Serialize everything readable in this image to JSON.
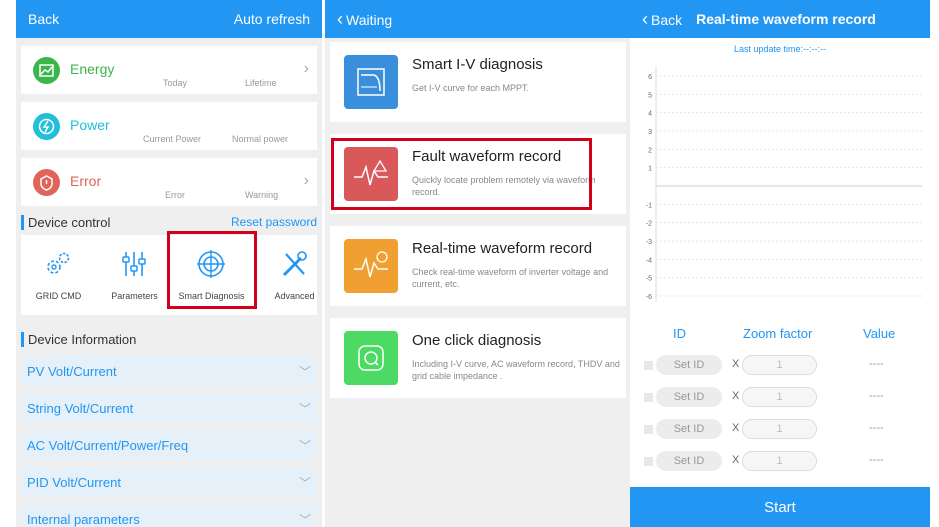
{
  "panel1": {
    "back": "Back",
    "auto_refresh": "Auto refresh",
    "energy": {
      "title": "Energy",
      "sub1": "Today",
      "sub2": "Lifetime",
      "color": "#3cb54a"
    },
    "power": {
      "title": "Power",
      "sub1": "Current Power",
      "sub2": "Normal power",
      "color": "#21c0d8"
    },
    "error": {
      "title": "Error",
      "sub1": "Error",
      "sub2": "Warning",
      "color": "#e0645a"
    },
    "device_control": "Device control",
    "reset_password": "Reset password",
    "controls": [
      "GRID CMD",
      "Parameters",
      "Smart Diagnosis",
      "Advanced"
    ],
    "device_information": "Device Information",
    "accordions": [
      "PV Volt/Current",
      "String Volt/Current",
      "AC Volt/Current/Power/Freq",
      "PID Volt/Current",
      "Internal parameters"
    ]
  },
  "panel2": {
    "back": "Waiting",
    "cards": [
      {
        "title": "Smart I-V diagnosis",
        "desc": "Get I-V curve for each MPPT.",
        "icon": "iv-curve-icon",
        "color": "#3a8fdc"
      },
      {
        "title": "Fault waveform record",
        "desc": "Quickly locate problem remotely via waveform record.",
        "icon": "fault-waveform-icon",
        "color": "#d9595b"
      },
      {
        "title": "Real-time waveform record",
        "desc": "Check real-time waveform of inverter voltage and current, etc.",
        "icon": "realtime-waveform-icon",
        "color": "#f0a030"
      },
      {
        "title": "One click diagnosis",
        "desc": "Including I-V curve, AC waveform record, THDV and grid cable impedance .",
        "icon": "one-click-icon",
        "color": "#4cd964"
      }
    ]
  },
  "panel3": {
    "back": "Back",
    "title": "Real-time waveform record",
    "last_update": "Last update time:--:--:--",
    "chart_data": {
      "type": "line",
      "ylim": [
        -6,
        6
      ],
      "yticks": [
        "6",
        "5",
        "4",
        "3",
        "2",
        "1",
        "-1",
        "-2",
        "-3",
        "-4",
        "-5",
        "-6"
      ],
      "series": []
    },
    "col_id": "ID",
    "col_zoom": "Zoom factor",
    "col_value": "Value",
    "rows": [
      {
        "set_id": "Set ID",
        "x": "X",
        "zoom": "1",
        "value": "----"
      },
      {
        "set_id": "Set ID",
        "x": "X",
        "zoom": "1",
        "value": "----"
      },
      {
        "set_id": "Set ID",
        "x": "X",
        "zoom": "1",
        "value": "----"
      },
      {
        "set_id": "Set ID",
        "x": "X",
        "zoom": "1",
        "value": "----"
      }
    ],
    "start": "Start"
  }
}
